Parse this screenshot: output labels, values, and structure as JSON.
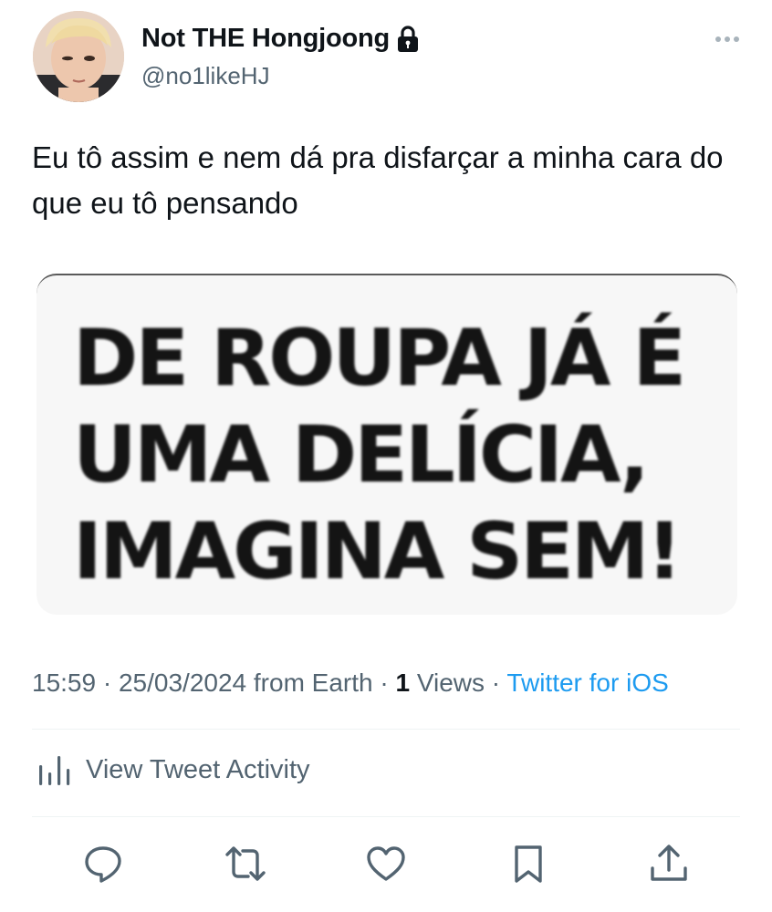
{
  "tweet": {
    "author": {
      "display_name": "Not THE Hongjoong",
      "handle": "@no1likeHJ",
      "protected_icon": "lock-icon",
      "avatar": "profile-photo"
    },
    "text": "Eu tô assim e nem dá pra disfarçar a minha cara do que eu tô pensando",
    "media": {
      "lines": [
        "DE ROUPA JÁ É",
        "UMA DELÍCIA,",
        "IMAGINA SEM!"
      ]
    },
    "meta": {
      "time": "15:59",
      "separator": " · ",
      "date": "25/03/2024",
      "location": " from Earth",
      "views_count": "1",
      "views_label": " Views",
      "source": "Twitter for iOS"
    },
    "activity": {
      "icon": "bar-chart-icon",
      "label": "View Tweet Activity"
    },
    "actions": [
      {
        "name": "reply",
        "icon": "reply-icon"
      },
      {
        "name": "retweet",
        "icon": "retweet-icon"
      },
      {
        "name": "like",
        "icon": "heart-icon"
      },
      {
        "name": "bookmark",
        "icon": "bookmark-icon"
      },
      {
        "name": "share",
        "icon": "share-icon"
      }
    ],
    "colors": {
      "text": "#0f1419",
      "secondary": "#536471",
      "link": "#1d9bf0"
    }
  }
}
